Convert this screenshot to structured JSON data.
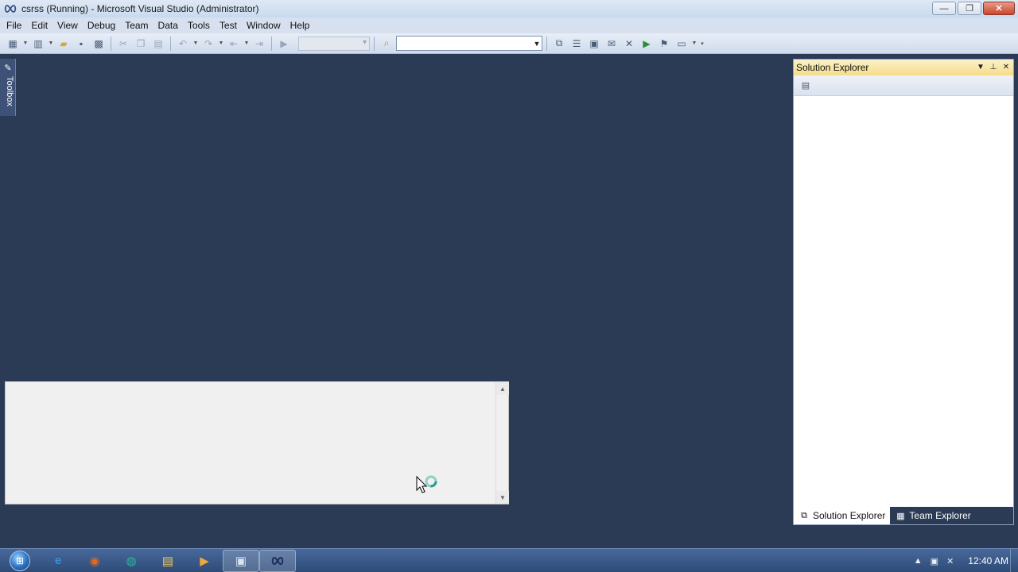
{
  "window": {
    "title": "csrss (Running) - Microsoft Visual Studio (Administrator)",
    "minimize_glyph": "—",
    "restore_glyph": "❐",
    "close_glyph": "✕"
  },
  "menu": [
    "File",
    "Edit",
    "View",
    "Debug",
    "Team",
    "Data",
    "Tools",
    "Test",
    "Window",
    "Help"
  ],
  "toolbar": {
    "find_combo_value": "",
    "config_combo_value": ""
  },
  "toolbox": {
    "label": "Toolbox"
  },
  "solution_explorer": {
    "title": "Solution Explorer",
    "tabs": [
      {
        "label": "Solution Explorer",
        "icon": "solution-explorer-icon"
      },
      {
        "label": "Team Explorer",
        "icon": "team-explorer-icon"
      }
    ]
  },
  "taskbar": {
    "apps": [
      {
        "name": "internet-explorer",
        "glyph": "e"
      },
      {
        "name": "firefox",
        "glyph": "◉"
      },
      {
        "name": "web-browser",
        "glyph": "◍"
      },
      {
        "name": "file-explorer",
        "glyph": "▤"
      },
      {
        "name": "media-player",
        "glyph": "▶"
      },
      {
        "name": "command-prompt",
        "glyph": "▣"
      },
      {
        "name": "visual-studio",
        "glyph": "∞"
      }
    ],
    "clock": "12:40 AM"
  },
  "colors": {
    "workspace": "#2b3a55",
    "panel_header": "#f5dc8a"
  }
}
